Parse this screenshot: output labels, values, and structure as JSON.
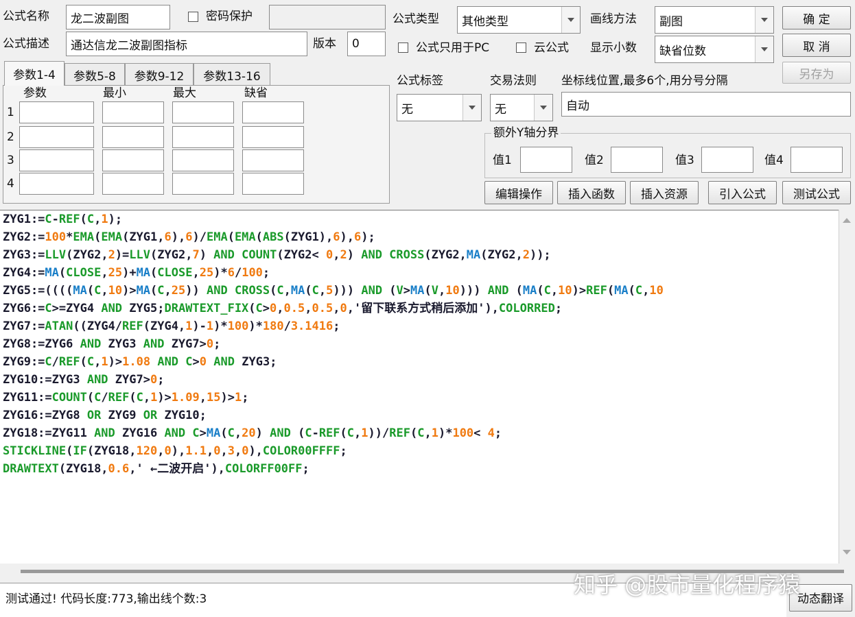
{
  "top": {
    "formula_name_label": "公式名称",
    "formula_name_value": "龙二波副图",
    "password_label": "密码保护",
    "password_value": "",
    "formula_desc_label": "公式描述",
    "formula_desc_value": "通达信龙二波副图指标",
    "version_label": "版本",
    "version_value": "0",
    "formula_type_label": "公式类型",
    "formula_type_value": "其他类型",
    "draw_method_label": "画线方法",
    "draw_method_value": "副图",
    "pc_only_label": "公式只用于PC",
    "cloud_label": "云公式",
    "decimals_label": "显示小数",
    "decimals_value": "缺省位数",
    "ok_button": "确  定",
    "cancel_button": "取  消",
    "save_as_button": "另存为"
  },
  "params": {
    "tabs": [
      "参数1-4",
      "参数5-8",
      "参数9-12",
      "参数13-16"
    ],
    "headers": [
      "参数",
      "最小",
      "最大",
      "缺省"
    ],
    "row_numbers": [
      "1",
      "2",
      "3",
      "4"
    ]
  },
  "middle": {
    "formula_tag_label": "公式标签",
    "formula_tag_value": "无",
    "trade_rule_label": "交易法则",
    "trade_rule_value": "无",
    "axis_label": "坐标线位置,最多6个,用分号分隔",
    "axis_value": "自动",
    "extra_y_label": "额外Y轴分界",
    "value_labels": [
      "值1",
      "值2",
      "值3",
      "值4"
    ]
  },
  "actions": {
    "edit_ops": "编辑操作",
    "insert_func": "插入函数",
    "insert_res": "插入资源",
    "import_formula": "引入公式",
    "test_formula": "测试公式"
  },
  "code_lines": [
    [
      [
        "ZYG1:=",
        "v"
      ],
      [
        "C",
        "g"
      ],
      [
        "-",
        "v"
      ],
      [
        "REF",
        "g"
      ],
      [
        "(",
        "v"
      ],
      [
        "C",
        "g"
      ],
      [
        ",",
        "v"
      ],
      [
        "1",
        "o"
      ],
      [
        ");",
        "v"
      ]
    ],
    [
      [
        "ZYG2:=",
        "v"
      ],
      [
        "100",
        "o"
      ],
      [
        "*",
        "v"
      ],
      [
        "EMA",
        "g"
      ],
      [
        "(",
        "v"
      ],
      [
        "EMA",
        "g"
      ],
      [
        "(ZYG1,",
        "v"
      ],
      [
        "6",
        "o"
      ],
      [
        "),",
        "v"
      ],
      [
        "6",
        "o"
      ],
      [
        ")/",
        "v"
      ],
      [
        "EMA",
        "g"
      ],
      [
        "(",
        "v"
      ],
      [
        "EMA",
        "g"
      ],
      [
        "(",
        "v"
      ],
      [
        "ABS",
        "g"
      ],
      [
        "(ZYG1),",
        "v"
      ],
      [
        "6",
        "o"
      ],
      [
        "),",
        "v"
      ],
      [
        "6",
        "o"
      ],
      [
        ");",
        "v"
      ]
    ],
    [
      [
        "ZYG3:=",
        "v"
      ],
      [
        "LLV",
        "g"
      ],
      [
        "(ZYG2,",
        "v"
      ],
      [
        "2",
        "o"
      ],
      [
        ")=",
        "v"
      ],
      [
        "LLV",
        "g"
      ],
      [
        "(ZYG2,",
        "v"
      ],
      [
        "7",
        "o"
      ],
      [
        ") ",
        "v"
      ],
      [
        "AND",
        "g"
      ],
      [
        " ",
        "v"
      ],
      [
        "COUNT",
        "g"
      ],
      [
        "(ZYG2< ",
        "v"
      ],
      [
        "0",
        "o"
      ],
      [
        ",",
        "v"
      ],
      [
        "2",
        "o"
      ],
      [
        ") ",
        "v"
      ],
      [
        "AND",
        "g"
      ],
      [
        " ",
        "v"
      ],
      [
        "CROSS",
        "g"
      ],
      [
        "(ZYG2,",
        "v"
      ],
      [
        "MA",
        "b"
      ],
      [
        "(ZYG2,",
        "v"
      ],
      [
        "2",
        "o"
      ],
      [
        "));",
        "v"
      ]
    ],
    [
      [
        "ZYG4:=",
        "v"
      ],
      [
        "MA",
        "b"
      ],
      [
        "(",
        "v"
      ],
      [
        "CLOSE",
        "g"
      ],
      [
        ",",
        "v"
      ],
      [
        "25",
        "o"
      ],
      [
        ")+",
        "v"
      ],
      [
        "MA",
        "b"
      ],
      [
        "(",
        "v"
      ],
      [
        "CLOSE",
        "g"
      ],
      [
        ",",
        "v"
      ],
      [
        "25",
        "o"
      ],
      [
        ")*",
        "v"
      ],
      [
        "6",
        "o"
      ],
      [
        "/",
        "v"
      ],
      [
        "100",
        "o"
      ],
      [
        ";",
        "v"
      ]
    ],
    [
      [
        "ZYG5:=((((",
        "v"
      ],
      [
        "MA",
        "b"
      ],
      [
        "(",
        "v"
      ],
      [
        "C",
        "g"
      ],
      [
        ",",
        "v"
      ],
      [
        "10",
        "o"
      ],
      [
        ")>",
        "v"
      ],
      [
        "MA",
        "b"
      ],
      [
        "(",
        "v"
      ],
      [
        "C",
        "g"
      ],
      [
        ",",
        "v"
      ],
      [
        "25",
        "o"
      ],
      [
        ")) ",
        "v"
      ],
      [
        "AND",
        "g"
      ],
      [
        " ",
        "v"
      ],
      [
        "CROSS",
        "g"
      ],
      [
        "(",
        "v"
      ],
      [
        "C",
        "g"
      ],
      [
        ",",
        "v"
      ],
      [
        "MA",
        "b"
      ],
      [
        "(",
        "v"
      ],
      [
        "C",
        "g"
      ],
      [
        ",",
        "v"
      ],
      [
        "5",
        "o"
      ],
      [
        "))) ",
        "v"
      ],
      [
        "AND",
        "g"
      ],
      [
        " (",
        "v"
      ],
      [
        "V",
        "g"
      ],
      [
        ">",
        "v"
      ],
      [
        "MA",
        "b"
      ],
      [
        "(",
        "v"
      ],
      [
        "V",
        "g"
      ],
      [
        ",",
        "v"
      ],
      [
        "10",
        "o"
      ],
      [
        "))) ",
        "v"
      ],
      [
        "AND",
        "g"
      ],
      [
        " (",
        "v"
      ],
      [
        "MA",
        "b"
      ],
      [
        "(",
        "v"
      ],
      [
        "C",
        "g"
      ],
      [
        ",",
        "v"
      ],
      [
        "10",
        "o"
      ],
      [
        ")>",
        "v"
      ],
      [
        "REF",
        "g"
      ],
      [
        "(",
        "v"
      ],
      [
        "MA",
        "b"
      ],
      [
        "(",
        "v"
      ],
      [
        "C",
        "g"
      ],
      [
        ",",
        "v"
      ],
      [
        "10",
        "o"
      ]
    ],
    [
      [
        "ZYG6:=",
        "v"
      ],
      [
        "C",
        "g"
      ],
      [
        ">=ZYG4 ",
        "v"
      ],
      [
        "AND",
        "g"
      ],
      [
        " ZYG5;",
        "v"
      ],
      [
        "DRAWTEXT_FIX",
        "g"
      ],
      [
        "(",
        "v"
      ],
      [
        "C",
        "g"
      ],
      [
        ">",
        "v"
      ],
      [
        "0",
        "o"
      ],
      [
        ",",
        "v"
      ],
      [
        "0.5",
        "o"
      ],
      [
        ",",
        "v"
      ],
      [
        "0.5",
        "o"
      ],
      [
        ",",
        "v"
      ],
      [
        "0",
        "o"
      ],
      [
        ",'留下联系方式稍后添加'),",
        "v"
      ],
      [
        "COLORRED",
        "g"
      ],
      [
        ";",
        "v"
      ]
    ],
    [
      [
        "ZYG7:=",
        "v"
      ],
      [
        "ATAN",
        "g"
      ],
      [
        "((ZYG4/",
        "v"
      ],
      [
        "REF",
        "g"
      ],
      [
        "(ZYG4,",
        "v"
      ],
      [
        "1",
        "o"
      ],
      [
        ")-",
        "v"
      ],
      [
        "1",
        "o"
      ],
      [
        ")*",
        "v"
      ],
      [
        "100",
        "o"
      ],
      [
        ")*",
        "v"
      ],
      [
        "180",
        "o"
      ],
      [
        "/",
        "v"
      ],
      [
        "3.1416",
        "o"
      ],
      [
        ";",
        "v"
      ]
    ],
    [
      [
        "ZYG8:=ZYG6 ",
        "v"
      ],
      [
        "AND",
        "g"
      ],
      [
        " ZYG3 ",
        "v"
      ],
      [
        "AND",
        "g"
      ],
      [
        " ZYG7>",
        "v"
      ],
      [
        "0",
        "o"
      ],
      [
        ";",
        "v"
      ]
    ],
    [
      [
        "ZYG9:=",
        "v"
      ],
      [
        "C",
        "g"
      ],
      [
        "/",
        "v"
      ],
      [
        "REF",
        "g"
      ],
      [
        "(",
        "v"
      ],
      [
        "C",
        "g"
      ],
      [
        ",",
        "v"
      ],
      [
        "1",
        "o"
      ],
      [
        ")>",
        "v"
      ],
      [
        "1.08",
        "o"
      ],
      [
        " ",
        "v"
      ],
      [
        "AND",
        "g"
      ],
      [
        " ",
        "v"
      ],
      [
        "C",
        "g"
      ],
      [
        ">",
        "v"
      ],
      [
        "0",
        "o"
      ],
      [
        " ",
        "v"
      ],
      [
        "AND",
        "g"
      ],
      [
        " ZYG3;",
        "v"
      ]
    ],
    [
      [
        "ZYG10:=ZYG3 ",
        "v"
      ],
      [
        "AND",
        "g"
      ],
      [
        " ZYG7>",
        "v"
      ],
      [
        "0",
        "o"
      ],
      [
        ";",
        "v"
      ]
    ],
    [
      [
        "ZYG11:=",
        "v"
      ],
      [
        "COUNT",
        "g"
      ],
      [
        "(",
        "v"
      ],
      [
        "C",
        "g"
      ],
      [
        "/",
        "v"
      ],
      [
        "REF",
        "g"
      ],
      [
        "(",
        "v"
      ],
      [
        "C",
        "g"
      ],
      [
        ",",
        "v"
      ],
      [
        "1",
        "o"
      ],
      [
        ")>",
        "v"
      ],
      [
        "1.09",
        "o"
      ],
      [
        ",",
        "v"
      ],
      [
        "15",
        "o"
      ],
      [
        ")>",
        "v"
      ],
      [
        "1",
        "o"
      ],
      [
        ";",
        "v"
      ]
    ],
    [
      [
        "ZYG16:=ZYG8 ",
        "v"
      ],
      [
        "OR",
        "g"
      ],
      [
        " ZYG9 ",
        "v"
      ],
      [
        "OR",
        "g"
      ],
      [
        " ZYG10;",
        "v"
      ]
    ],
    [
      [
        "ZYG18:=ZYG11 ",
        "v"
      ],
      [
        "AND",
        "g"
      ],
      [
        " ZYG16 ",
        "v"
      ],
      [
        "AND",
        "g"
      ],
      [
        " ",
        "v"
      ],
      [
        "C",
        "g"
      ],
      [
        ">",
        "v"
      ],
      [
        "MA",
        "b"
      ],
      [
        "(",
        "v"
      ],
      [
        "C",
        "g"
      ],
      [
        ",",
        "v"
      ],
      [
        "20",
        "o"
      ],
      [
        ") ",
        "v"
      ],
      [
        "AND",
        "g"
      ],
      [
        " (",
        "v"
      ],
      [
        "C",
        "g"
      ],
      [
        "-",
        "v"
      ],
      [
        "REF",
        "g"
      ],
      [
        "(",
        "v"
      ],
      [
        "C",
        "g"
      ],
      [
        ",",
        "v"
      ],
      [
        "1",
        "o"
      ],
      [
        "))/",
        "v"
      ],
      [
        "REF",
        "g"
      ],
      [
        "(",
        "v"
      ],
      [
        "C",
        "g"
      ],
      [
        ",",
        "v"
      ],
      [
        "1",
        "o"
      ],
      [
        ")*",
        "v"
      ],
      [
        "100",
        "o"
      ],
      [
        "< ",
        "v"
      ],
      [
        "4",
        "o"
      ],
      [
        ";",
        "v"
      ]
    ],
    [
      [
        "STICKLINE",
        "g"
      ],
      [
        "(",
        "v"
      ],
      [
        "IF",
        "g"
      ],
      [
        "(ZYG18,",
        "v"
      ],
      [
        "120",
        "o"
      ],
      [
        ",",
        "v"
      ],
      [
        "0",
        "o"
      ],
      [
        "),",
        "v"
      ],
      [
        "1.1",
        "o"
      ],
      [
        ",",
        "v"
      ],
      [
        "0",
        "o"
      ],
      [
        ",",
        "v"
      ],
      [
        "3",
        "o"
      ],
      [
        ",",
        "v"
      ],
      [
        "0",
        "o"
      ],
      [
        "),",
        "v"
      ],
      [
        "COLOR00FFFF",
        "g"
      ],
      [
        ";",
        "v"
      ]
    ],
    [
      [
        "DRAWTEXT",
        "g"
      ],
      [
        "(ZYG18,",
        "v"
      ],
      [
        "0.6",
        "o"
      ],
      [
        ",' ←二波开启'),",
        "v"
      ],
      [
        "COLORFF00FF",
        "g"
      ],
      [
        ";",
        "v"
      ]
    ]
  ],
  "code_colors": {
    "v": "#1a1a2e",
    "g": "#1a9a2a",
    "o": "#f07a10",
    "b": "#1a7fc8"
  },
  "status": {
    "message": "测试通过! 代码长度:773,输出线个数:3",
    "dynamic_translate": "动态翻译"
  },
  "watermark": "知乎 @股市量化程序猿"
}
